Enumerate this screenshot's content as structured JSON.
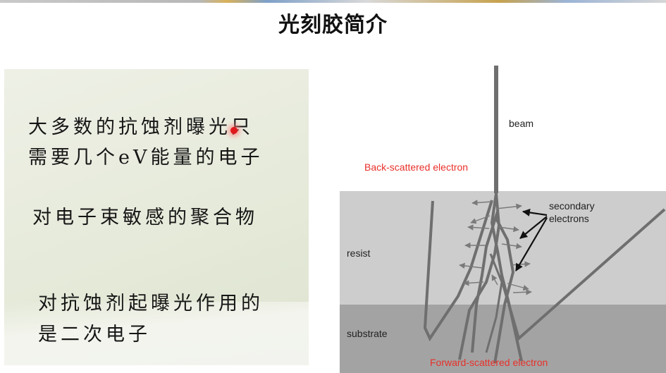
{
  "slide": {
    "title": "光刻胶简介"
  },
  "left_panel": {
    "lines": [
      "大多数的抗蚀剂曝光只",
      "需要几个eV能量的电子",
      "对电子束敏感的聚合物",
      "对抗蚀剂起曝光作用的",
      "是二次电子"
    ]
  },
  "diagram": {
    "labels": {
      "beam": "beam",
      "back_scattered": "Back-scattered electron",
      "secondary_line1": "secondary",
      "secondary_line2": "electrons",
      "resist": "resist",
      "substrate": "substrate",
      "forward_scattered": "Forward-scattered electron"
    },
    "colors": {
      "resist": "#cdcdcd",
      "substrate": "#a3a3a3",
      "tracks": "#6f6f6f",
      "label_red": "#e8302a",
      "arrows": "#7a7a7a"
    }
  }
}
